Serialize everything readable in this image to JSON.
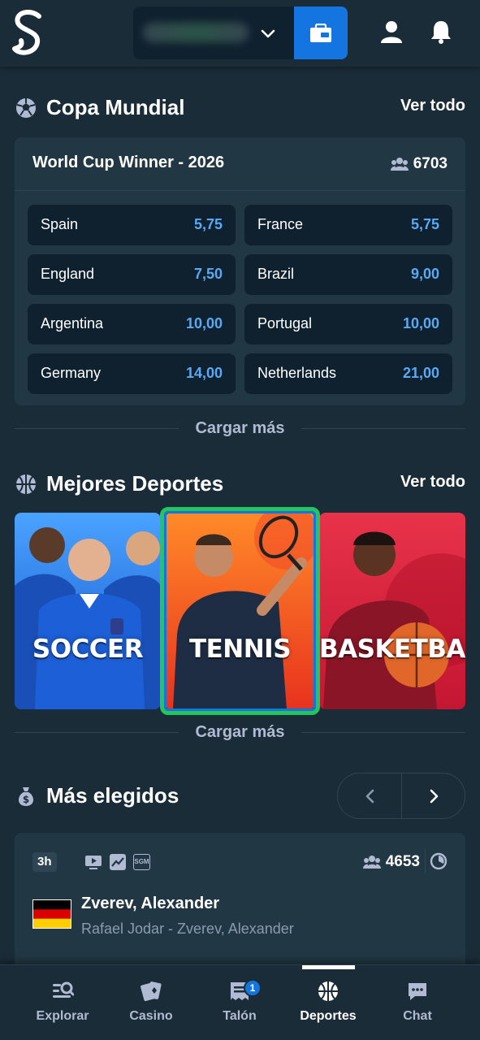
{
  "header": {
    "logo_icon": "stake-s-logo",
    "balance_icon": "chevron-down-icon",
    "wallet_icon": "wallet-icon",
    "profile_icon": "user-icon",
    "notifications_icon": "bell-icon",
    "accent_color": "#1475e1"
  },
  "world_cup": {
    "section_title": "Copa Mundial",
    "section_icon": "soccer-ball-icon",
    "see_all": "Ver todo",
    "market_title": "World Cup Winner - 2026",
    "participants": "6703",
    "outcomes": [
      {
        "team": "Spain",
        "odds": "5,75"
      },
      {
        "team": "France",
        "odds": "5,75"
      },
      {
        "team": "England",
        "odds": "7,50"
      },
      {
        "team": "Brazil",
        "odds": "9,00"
      },
      {
        "team": "Argentina",
        "odds": "10,00"
      },
      {
        "team": "Portugal",
        "odds": "10,00"
      },
      {
        "team": "Germany",
        "odds": "14,00"
      },
      {
        "team": "Netherlands",
        "odds": "21,00"
      }
    ],
    "load_more": "Cargar más"
  },
  "top_sports": {
    "section_title": "Mejores Deportes",
    "section_icon": "basketball-icon",
    "see_all": "Ver todo",
    "tiles": [
      {
        "label": "SOCCER",
        "color": "#1d5fd6"
      },
      {
        "label": "TENNIS",
        "color": "#f05a1e"
      },
      {
        "label": "BASKETBALL",
        "color": "#d11f3c"
      }
    ],
    "focus_color": "#22c55e",
    "load_more": "Cargar más"
  },
  "most_picked": {
    "section_title": "Más elegidos",
    "section_icon": "money-bag-icon",
    "prev_icon": "chevron-left-icon",
    "next_icon": "chevron-right-icon",
    "event": {
      "time": "3h",
      "participants": "4653",
      "sgm_label": "SGM",
      "player": "Zverev, Alexander",
      "match": "Rafael Jodar - Zverev, Alexander",
      "flag": "germany-flag"
    }
  },
  "bottom_nav": {
    "items": [
      {
        "label": "Explorar",
        "icon": "explore-icon"
      },
      {
        "label": "Casino",
        "icon": "casino-cards-icon"
      },
      {
        "label": "Talón",
        "icon": "betslip-icon",
        "badge": "1"
      },
      {
        "label": "Deportes",
        "icon": "sports-ball-icon",
        "active": true
      },
      {
        "label": "Chat",
        "icon": "chat-icon"
      }
    ]
  }
}
